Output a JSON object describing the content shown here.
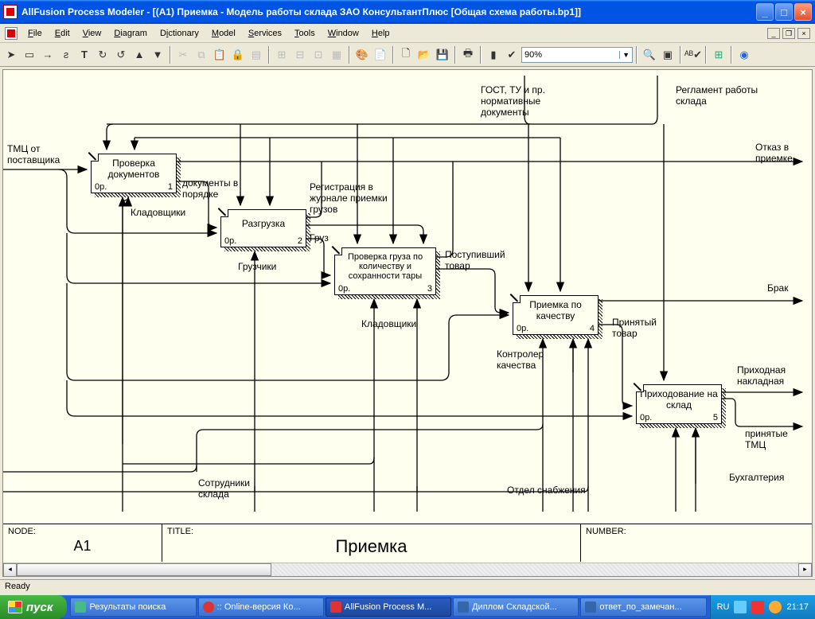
{
  "window": {
    "title": "AllFusion Process Modeler  - [(A1) Приемка - Модель работы склада ЗАО КонсультантПлюс  [Общая схема работы.bp1]]"
  },
  "menu": {
    "file": "File",
    "edit": "Edit",
    "view": "View",
    "diagram": "Diagram",
    "dictionary": "Dictionary",
    "model": "Model",
    "services": "Services",
    "tools": "Tools",
    "window": "Window",
    "help": "Help"
  },
  "toolbar": {
    "zoom": "90%"
  },
  "diagram": {
    "footer": {
      "node_label": "NODE:",
      "node_value": "A1",
      "title_label": "TITLE:",
      "title_value": "Приемка",
      "number_label": "NUMBER:"
    },
    "boxes": {
      "b1": {
        "label": "Проверка документов",
        "op": "0р.",
        "num": "1"
      },
      "b2": {
        "label": "Разгрузка",
        "op": "0р.",
        "num": "2"
      },
      "b3": {
        "label": "Проверка груза по количеству и сохранности тары",
        "op": "0р.",
        "num": "3"
      },
      "b4": {
        "label": "Приемка по качеству",
        "op": "0р.",
        "num": "4"
      },
      "b5": {
        "label": "Приходование на склад",
        "op": "0р.",
        "num": "5"
      }
    },
    "labels": {
      "tmc": "ТМЦ от поставщика",
      "gost": "ГОСТ, ТУ и пр. нормативные документы",
      "reglament": "Регламент работы склада",
      "otkaz": "Отказ в приемке",
      "docs_ok": "документы в порядке",
      "kladov": "Кладовщики",
      "reg_journal": "Регистрация в журнале приемки грузов",
      "gruz": "Груз",
      "gruzchiki": "Грузчики",
      "kladov2": "Кладовщики",
      "post_tovar": "Поступивший товар",
      "brak": "Брак",
      "prin_tovar": "Принятый товар",
      "kontroler": "Контролер качества",
      "prih_nakl": "Приходная накладная",
      "prin_tmc": "принятые ТМЦ",
      "sotrud": "Сотрудники склада",
      "otdel": "Отдел снабжения",
      "buh": "Бухгалтерия"
    }
  },
  "status": {
    "ready": "Ready"
  },
  "taskbar": {
    "start": "пуск",
    "tasks": [
      "Результаты поиска",
      ":: Online-версия Ко...",
      "AllFusion Process M...",
      "Диплом Складской...",
      "ответ_по_замечан..."
    ],
    "lang": "RU",
    "clock": "21:17"
  }
}
